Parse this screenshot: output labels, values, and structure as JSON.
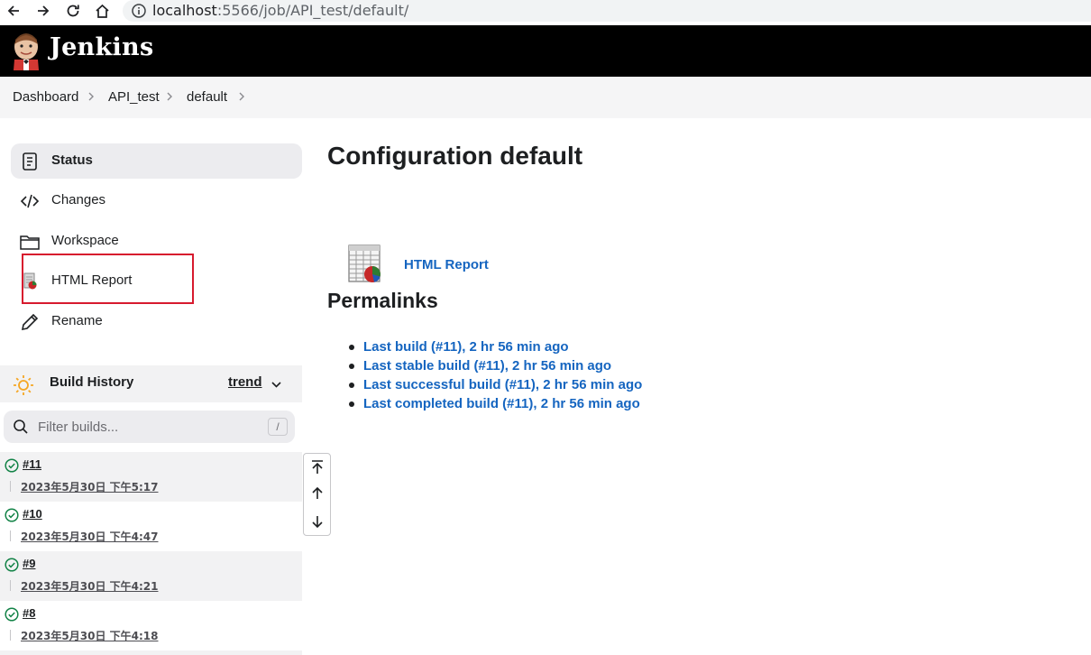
{
  "browser": {
    "url_host": "localhost",
    "url_path": ":5566/job/API_test/default/"
  },
  "header": {
    "logo_text": "Jenkins"
  },
  "breadcrumb": [
    "Dashboard",
    "API_test",
    "default"
  ],
  "sidebar": {
    "tasks": [
      {
        "label": "Status",
        "icon": "status-icon",
        "active": true
      },
      {
        "label": "Changes",
        "icon": "code-icon"
      },
      {
        "label": "Workspace",
        "icon": "folder-icon"
      },
      {
        "label": "HTML Report",
        "icon": "report-icon"
      },
      {
        "label": "Rename",
        "icon": "pencil-icon"
      }
    ]
  },
  "build_history": {
    "title": "Build History",
    "trend_label": "trend",
    "filter_placeholder": "Filter builds...",
    "filter_shortcut": "/",
    "builds": [
      {
        "number": "#11",
        "date": "2023年5月30日 下午5:17"
      },
      {
        "number": "#10",
        "date": "2023年5月30日 下午4:47"
      },
      {
        "number": "#9",
        "date": "2023年5月30日 下午4:21"
      },
      {
        "number": "#8",
        "date": "2023年5月30日 下午4:18"
      }
    ]
  },
  "main": {
    "title": "Configuration default",
    "report_link": "HTML Report",
    "permalinks_title": "Permalinks",
    "permalinks": [
      "Last build (#11), 2 hr 56 min ago",
      "Last stable build (#11), 2 hr 56 min ago",
      "Last successful build (#11), 2 hr 56 min ago",
      "Last completed build (#11), 2 hr 56 min ago"
    ]
  },
  "colors": {
    "link": "#1565c0",
    "success": "#138347",
    "highlight": "#d71a2e",
    "header_bg": "#000000"
  }
}
